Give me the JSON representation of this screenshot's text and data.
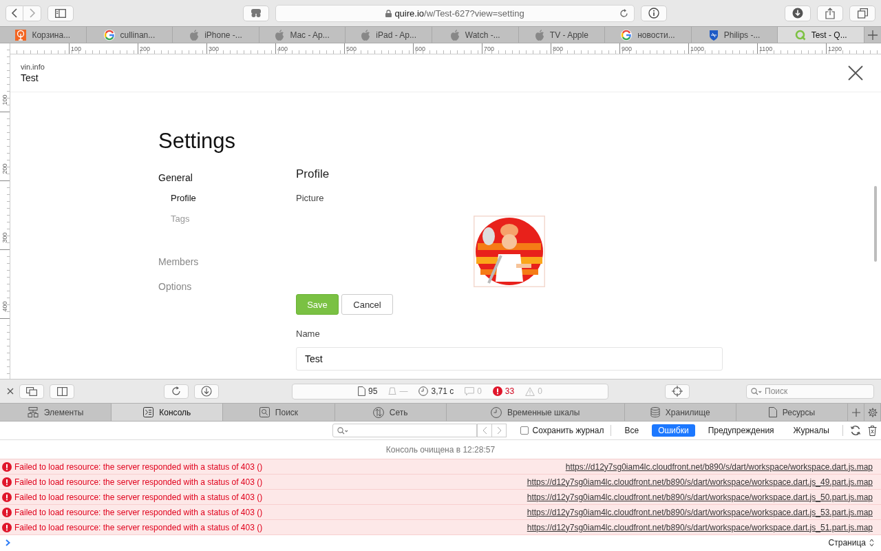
{
  "browser": {
    "address": {
      "host": "quire.io",
      "path": "/w/Test-627?view=setting"
    },
    "tabs": [
      {
        "title": "Корзина...",
        "kind": "tree",
        "selected": false
      },
      {
        "title": "cullinan...",
        "kind": "google",
        "selected": false
      },
      {
        "title": "iPhone -...",
        "kind": "apple",
        "selected": false
      },
      {
        "title": "Mac - Ap...",
        "kind": "apple",
        "selected": false
      },
      {
        "title": "iPad - Ap...",
        "kind": "apple",
        "selected": false
      },
      {
        "title": "Watch -...",
        "kind": "apple",
        "selected": false
      },
      {
        "title": "TV - Apple",
        "kind": "apple",
        "selected": false
      },
      {
        "title": "новости...",
        "kind": "google",
        "selected": false
      },
      {
        "title": "Philips -...",
        "kind": "shield",
        "selected": false
      },
      {
        "title": "Test - Q...",
        "kind": "ring",
        "selected": true
      }
    ]
  },
  "ruler": {
    "horizontal": [
      "100",
      "200",
      "300",
      "400",
      "500",
      "600",
      "700",
      "800",
      "900",
      "1000",
      "1100",
      "1200"
    ],
    "vertical": [
      "100",
      "200",
      "300",
      "400"
    ]
  },
  "page": {
    "org": "vin.info",
    "project": "Test",
    "title": "Settings",
    "nav": [
      {
        "label": "General",
        "selected": true,
        "children": [
          {
            "label": "Profile",
            "selected": true
          },
          {
            "label": "Tags",
            "selected": false
          }
        ]
      },
      {
        "label": "Members",
        "selected": false
      },
      {
        "label": "Options",
        "selected": false
      }
    ],
    "section": "Profile",
    "picture_label": "Picture",
    "buttons": [
      {
        "label": "Save",
        "kind": "primary"
      },
      {
        "label": "Cancel",
        "kind": "secondary"
      }
    ],
    "name_label": "Name",
    "name_value": "Test"
  },
  "devtools": {
    "stats": [
      {
        "kind": "resources",
        "text": "95"
      },
      {
        "kind": "bell",
        "text": "—"
      },
      {
        "kind": "clock",
        "text": "3,71 с"
      },
      {
        "kind": "messages",
        "text": "0"
      },
      {
        "kind": "errors",
        "text": "33"
      },
      {
        "kind": "warnings",
        "text": "0"
      }
    ],
    "search_placeholder": "Поиск",
    "tabs": [
      {
        "label": "Элементы",
        "kind": "elements",
        "selected": false
      },
      {
        "label": "Консоль",
        "kind": "console",
        "selected": true
      },
      {
        "label": "Поиск",
        "kind": "search",
        "selected": false
      },
      {
        "label": "Сеть",
        "kind": "network",
        "selected": false
      },
      {
        "label": "Временные шкалы",
        "kind": "timelines",
        "selected": false
      },
      {
        "label": "Хранилище",
        "kind": "storage",
        "selected": false
      },
      {
        "label": "Ресурсы",
        "kind": "resources",
        "selected": false
      }
    ],
    "preserve_log": {
      "label": "Сохранить журнал",
      "checked": false
    },
    "filters": [
      {
        "label": "Все",
        "selected": false
      },
      {
        "label": "Ошибки",
        "selected": true
      },
      {
        "label": "Предупреждения",
        "selected": false
      },
      {
        "label": "Журналы",
        "selected": false
      }
    ],
    "cleared": "Консоль очищена в 12:28:57",
    "messages": [
      {
        "text": "Failed to load resource: the server responded with a status of 403 ()",
        "url": "https://d12y7sg0iam4lc.cloudfront.net/b890/s/dart/workspace/workspace.dart.js.map"
      },
      {
        "text": "Failed to load resource: the server responded with a status of 403 ()",
        "url": "https://d12y7sg0iam4lc.cloudfront.net/b890/s/dart/workspace/workspace.dart.js_49.part.js.map"
      },
      {
        "text": "Failed to load resource: the server responded with a status of 403 ()",
        "url": "https://d12y7sg0iam4lc.cloudfront.net/b890/s/dart/workspace/workspace.dart.js_50.part.js.map"
      },
      {
        "text": "Failed to load resource: the server responded with a status of 403 ()",
        "url": "https://d12y7sg0iam4lc.cloudfront.net/b890/s/dart/workspace/workspace.dart.js_53.part.js.map"
      },
      {
        "text": "Failed to load resource: the server responded with a status of 403 ()",
        "url": "https://d12y7sg0iam4lc.cloudfront.net/b890/s/dart/workspace/workspace.dart.js_51.part.js.map"
      }
    ],
    "context": "Страница"
  }
}
